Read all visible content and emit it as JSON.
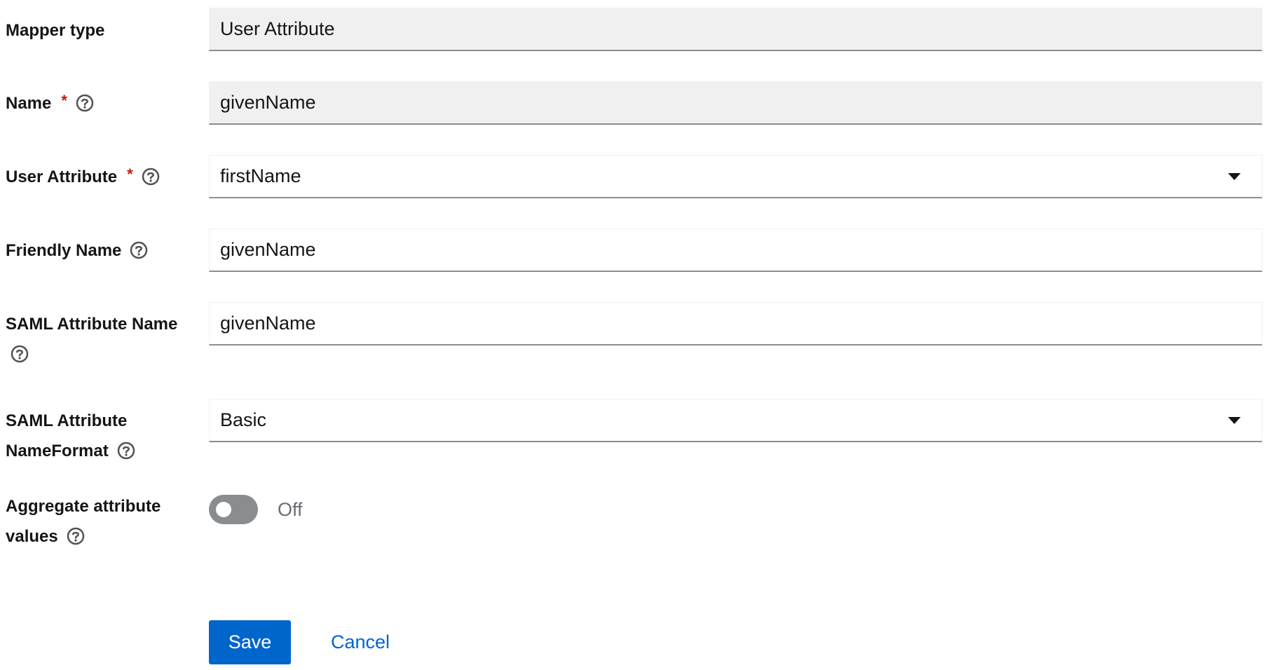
{
  "mapper_type": {
    "label": "Mapper type",
    "value": "User Attribute"
  },
  "name": {
    "label": "Name",
    "required": "*",
    "value": "givenName"
  },
  "user_attribute": {
    "label": "User Attribute",
    "required": "*",
    "value": "firstName"
  },
  "friendly_name": {
    "label": "Friendly Name",
    "value": "givenName"
  },
  "saml_attribute_name": {
    "label": "SAML Attribute Name",
    "value": "givenName"
  },
  "saml_attribute_nameformat": {
    "label_line1": "SAML Attribute",
    "label_line2": "NameFormat",
    "value": "Basic"
  },
  "aggregate_attribute_values": {
    "label_line1": "Aggregate attribute",
    "label_line2": "values",
    "state_label": "Off",
    "checked": false
  },
  "actions": {
    "save_label": "Save",
    "cancel_label": "Cancel"
  },
  "colors": {
    "primary": "#0066cc",
    "required": "#c9190b",
    "switch_off": "#8a8d90",
    "readonly_bg": "#f0f0f0"
  },
  "icons": {
    "help": "help-circle-icon",
    "dropdown": "caret-down-icon"
  }
}
